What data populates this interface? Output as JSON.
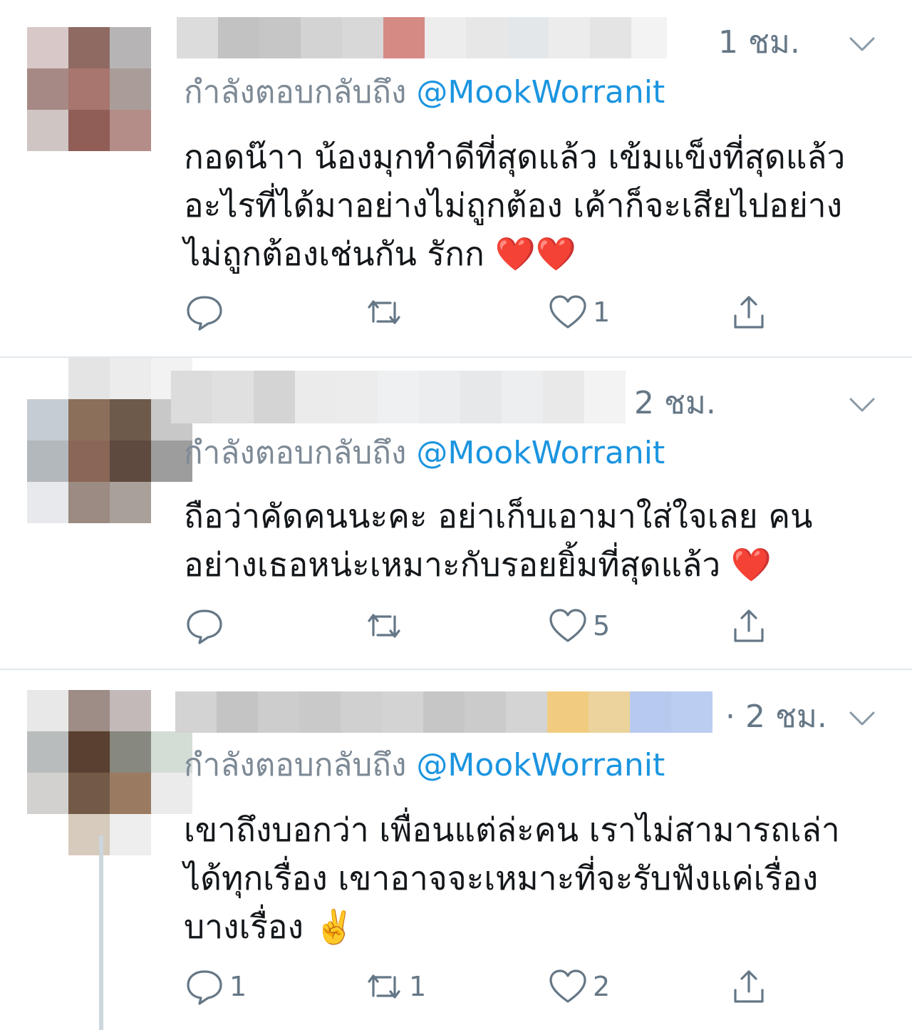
{
  "reply_prefix": "กำลังตอบกลับถึง",
  "reply_handle": "@MookWorranit",
  "icons": {
    "reply": "reply-icon",
    "retweet": "retweet-icon",
    "like": "heart-icon",
    "share": "share-icon",
    "menu": "chevron-down-icon"
  },
  "colors": {
    "link": "#1b95e0",
    "secondary_text": "#657786",
    "divider": "#e1e8ed"
  },
  "tweets": [
    {
      "time": "1 ชม.",
      "lines": [
        "กอดน๊าา น้องมุกทำดีที่สุดแล้ว เข้มแข็งที่สุดแล้ว",
        "อะไรที่ได้มาอย่างไม่ถูกต้อง เค้าก็จะเสียไปอย่าง",
        "ไม่ถูกต้องเช่นกัน รักก ❤️❤️"
      ],
      "replies": "",
      "retweets": "",
      "likes": "1"
    },
    {
      "time": "2 ชม.",
      "lines": [
        "ถือว่าคัดคนนะคะ อย่าเก็บเอามาใส่ใจเลย คน",
        "อย่างเธอหน่ะเหมาะกับรอยยิ้มที่สุดแล้ว ❤️"
      ],
      "replies": "",
      "retweets": "",
      "likes": "5"
    },
    {
      "time": "· 2 ชม.",
      "lines": [
        "เขาถึงบอกว่า เพื่อนแต่ล่ะคน เราไม่สามารถเล่า",
        "ได้ทุกเรื่อง เขาอาจจะเหมาะที่จะรับฟังแค่เรื่อง",
        "บางเรื่อง ✌️"
      ],
      "replies": "1",
      "retweets": "1",
      "likes": "2"
    }
  ]
}
